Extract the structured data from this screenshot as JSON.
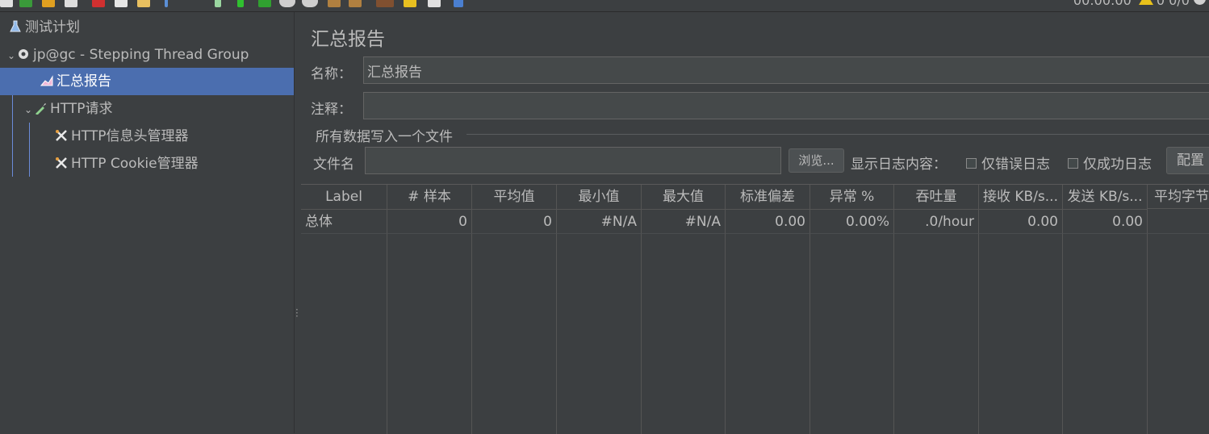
{
  "toolbar": {
    "icons": [
      "new-icon",
      "templates-icon",
      "open-icon",
      "save-icon",
      "cut-icon",
      "copy-icon",
      "paste-icon",
      "expand-icon",
      "collapse-icon",
      "toggle-icon",
      "start-icon",
      "start-no-pause-icon",
      "stop-icon",
      "shutdown-icon",
      "clear-icon",
      "clear-all-icon",
      "search-icon",
      "reset-search-icon",
      "function-helper-icon",
      "help-icon"
    ],
    "elapsed_time": "00:00:00",
    "error_count": "0",
    "threads": "0/0"
  },
  "tree": {
    "items": [
      {
        "label": "测试计划",
        "icon": "flask-icon"
      },
      {
        "label": "jp@gc - Stepping Thread Group",
        "icon": "gear-icon"
      },
      {
        "label": "汇总报告",
        "icon": "chart-icon"
      },
      {
        "label": "HTTP请求",
        "icon": "pipette-icon"
      },
      {
        "label": "HTTP信息头管理器",
        "icon": "tools-icon"
      },
      {
        "label": "HTTP Cookie管理器",
        "icon": "tools-icon"
      }
    ]
  },
  "panel": {
    "title": "汇总报告",
    "name_label": "名称：",
    "name_value": "汇总报告",
    "comment_label": "注释：",
    "comment_value": "",
    "fieldset_title": "所有数据写入一个文件",
    "filename_label": "文件名",
    "filename_value": "",
    "browse_button": "浏览...",
    "log_display_label": "显示日志内容：",
    "errors_only_label": "仅错误日志",
    "success_only_label": "仅成功日志",
    "configure_button": "配置"
  },
  "table": {
    "headers": [
      "Label",
      "# 样本",
      "平均值",
      "最小值",
      "最大值",
      "标准偏差",
      "异常 %",
      "吞吐量",
      "接收 KB/s...",
      "发送 KB/s...",
      "平均字节"
    ],
    "rows": [
      [
        "总体",
        "0",
        "0",
        "#N/A",
        "#N/A",
        "0.00",
        "0.00%",
        ".0/hour",
        "0.00",
        "0.00",
        ""
      ]
    ]
  },
  "colors": {
    "background": "#3c3f41",
    "selection": "#4b6eaf",
    "field_background": "#45494a",
    "text": "#bbbbbb"
  }
}
